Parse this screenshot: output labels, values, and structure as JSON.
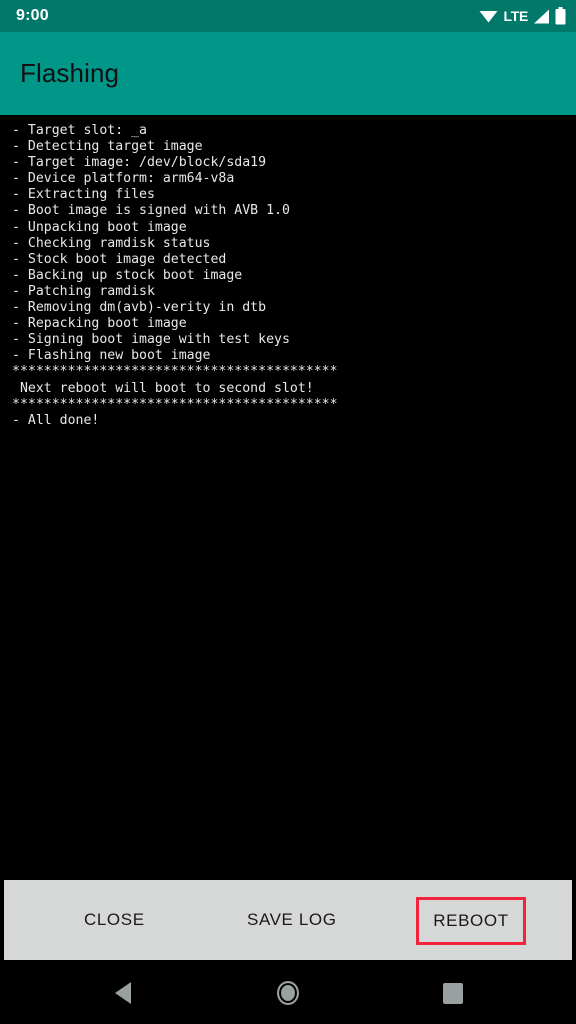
{
  "status_bar": {
    "time": "9:00",
    "network_label": "LTE",
    "icons": [
      "wifi-icon",
      "lte-label",
      "signal-icon",
      "battery-icon"
    ],
    "background_color": "#00796B"
  },
  "app_bar": {
    "title": "Flashing",
    "background_color": "#009688",
    "title_color": "#111111"
  },
  "console": {
    "background_color": "#000000",
    "text_color": "#e8e8e8",
    "lines": [
      "- Target slot: _a",
      "- Detecting target image",
      "- Target image: /dev/block/sda19",
      "- Device platform: arm64-v8a",
      "- Extracting files",
      "- Boot image is signed with AVB 1.0",
      "- Unpacking boot image",
      "- Checking ramdisk status",
      "- Stock boot image detected",
      "- Backing up stock boot image",
      "- Patching ramdisk",
      "- Removing dm(avb)-verity in dtb",
      "- Repacking boot image",
      "- Signing boot image with test keys",
      "- Flashing new boot image",
      "*****************************************",
      " Next reboot will boot to second slot!",
      "*****************************************",
      "- All done!"
    ],
    "log_text": "- Target slot: _a\n- Detecting target image\n- Target image: /dev/block/sda19\n- Device platform: arm64-v8a\n- Extracting files\n- Boot image is signed with AVB 1.0\n- Unpacking boot image\n- Checking ramdisk status\n- Stock boot image detected\n- Backing up stock boot image\n- Patching ramdisk\n- Removing dm(avb)-verity in dtb\n- Repacking boot image\n- Signing boot image with test keys\n- Flashing new boot image\n*****************************************\n Next reboot will boot to second slot!\n*****************************************\n- All done!"
  },
  "button_bar": {
    "background_color": "#D6D7D7",
    "close_label": "CLOSE",
    "save_log_label": "SAVE LOG",
    "reboot_label": "REBOOT",
    "highlight_color": "#F4233C",
    "highlighted_button": "REBOOT"
  },
  "nav_bar": {
    "background_color": "#000000",
    "icon_color": "#9AA0A0",
    "buttons": [
      "back-icon",
      "home-icon",
      "recents-icon"
    ]
  }
}
